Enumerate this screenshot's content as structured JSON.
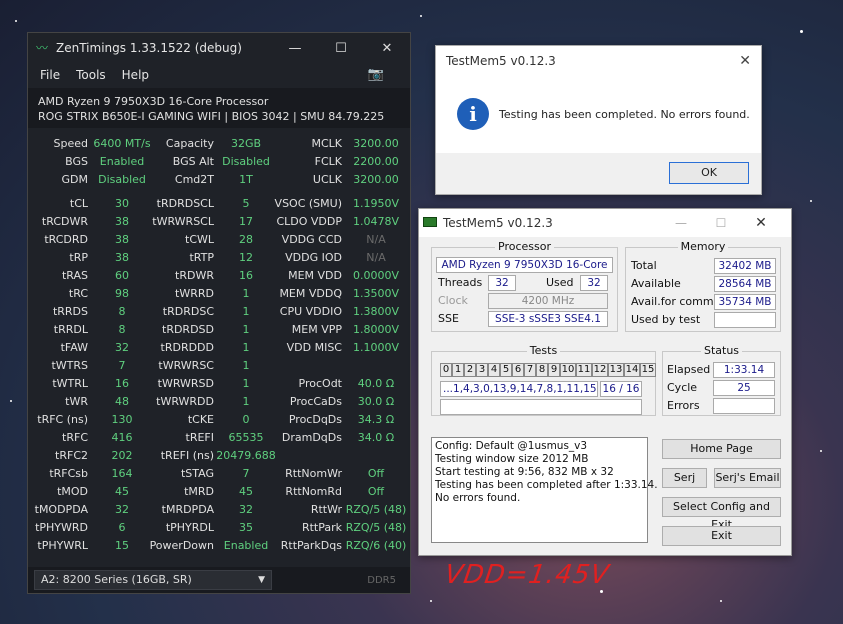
{
  "zentimings": {
    "title": "ZenTimings 1.33.1522 (debug)",
    "menu": [
      "File",
      "Tools",
      "Help"
    ],
    "cpu": "AMD Ryzen 9 7950X3D 16-Core Processor",
    "board": "ROG STRIX B650E-I GAMING WIFI | BIOS 3042 | SMU 84.79.225",
    "top_rows": [
      {
        "l1": "Speed",
        "v1": "6400 MT/s",
        "l2": "Capacity",
        "v2": "32GB",
        "l3": "MCLK",
        "v3": "3200.00"
      },
      {
        "l1": "BGS",
        "v1": "Enabled",
        "l2": "BGS Alt",
        "v2": "Disabled",
        "l3": "FCLK",
        "v3": "2200.00"
      },
      {
        "l1": "GDM",
        "v1": "Disabled",
        "l2": "Cmd2T",
        "v2": "1T",
        "l3": "UCLK",
        "v3": "3200.00"
      }
    ],
    "rows": [
      {
        "l1": "tCL",
        "v1": "30",
        "l2": "tRDRDSCL",
        "v2": "5",
        "l3": "VSOC (SMU)",
        "v3": "1.1950V"
      },
      {
        "l1": "tRCDWR",
        "v1": "38",
        "l2": "tWRWRSCL",
        "v2": "17",
        "l3": "CLDO VDDP",
        "v3": "1.0478V"
      },
      {
        "l1": "tRCDRD",
        "v1": "38",
        "l2": "tCWL",
        "v2": "28",
        "l3": "VDDG CCD",
        "v3": "N/A",
        "d": true
      },
      {
        "l1": "tRP",
        "v1": "38",
        "l2": "tRTP",
        "v2": "12",
        "l3": "VDDG IOD",
        "v3": "N/A",
        "d": true
      },
      {
        "l1": "tRAS",
        "v1": "60",
        "l2": "tRDWR",
        "v2": "16",
        "l3": "MEM VDD",
        "v3": "0.0000V"
      },
      {
        "l1": "tRC",
        "v1": "98",
        "l2": "tWRRD",
        "v2": "1",
        "l3": "MEM VDDQ",
        "v3": "1.3500V"
      },
      {
        "l1": "tRRDS",
        "v1": "8",
        "l2": "tRDRDSC",
        "v2": "1",
        "l3": "CPU VDDIO",
        "v3": "1.3800V"
      },
      {
        "l1": "tRRDL",
        "v1": "8",
        "l2": "tRDRDSD",
        "v2": "1",
        "l3": "MEM VPP",
        "v3": "1.8000V"
      },
      {
        "l1": "tFAW",
        "v1": "32",
        "l2": "tRDRDDD",
        "v2": "1",
        "l3": "VDD MISC",
        "v3": "1.1000V"
      },
      {
        "l1": "tWTRS",
        "v1": "7",
        "l2": "tWRWRSC",
        "v2": "1",
        "l3": "",
        "v3": ""
      },
      {
        "l1": "tWTRL",
        "v1": "16",
        "l2": "tWRWRSD",
        "v2": "1",
        "l3": "ProcOdt",
        "v3": "40.0 Ω"
      },
      {
        "l1": "tWR",
        "v1": "48",
        "l2": "tWRWRDD",
        "v2": "1",
        "l3": "ProcCaDs",
        "v3": "30.0 Ω"
      },
      {
        "l1": "tRFC (ns)",
        "v1": "130",
        "l2": "tCKE",
        "v2": "0",
        "l3": "ProcDqDs",
        "v3": "34.3 Ω"
      },
      {
        "l1": "tRFC",
        "v1": "416",
        "l2": "tREFI",
        "v2": "65535",
        "l3": "DramDqDs",
        "v3": "34.0 Ω"
      },
      {
        "l1": "tRFC2",
        "v1": "202",
        "l2": "tREFI (ns)",
        "v2": "20479.688",
        "l3": "",
        "v3": ""
      },
      {
        "l1": "tRFCsb",
        "v1": "164",
        "l2": "tSTAG",
        "v2": "7",
        "l3": "RttNomWr",
        "v3": "Off"
      },
      {
        "l1": "tMOD",
        "v1": "45",
        "l2": "tMRD",
        "v2": "45",
        "l3": "RttNomRd",
        "v3": "Off"
      },
      {
        "l1": "tMODPDA",
        "v1": "32",
        "l2": "tMRDPDA",
        "v2": "32",
        "l3": "RttWr",
        "v3": "RZQ/5 (48)"
      },
      {
        "l1": "tPHYWRD",
        "v1": "6",
        "l2": "tPHYRDL",
        "v2": "35",
        "l3": "RttPark",
        "v3": "RZQ/5 (48)"
      },
      {
        "l1": "tPHYWRL",
        "v1": "15",
        "l2": "PowerDown",
        "v2": "Enabled",
        "l3": "RttParkDqs",
        "v3": "RZQ/6 (40)"
      }
    ],
    "dimm_select": "A2: 8200 Series (16GB, SR)",
    "mem_type": "DDR5"
  },
  "dialog": {
    "title": "TestMem5 v0.12.3",
    "message": "Testing has been completed. No errors found.",
    "ok": "OK"
  },
  "testmem": {
    "title": "TestMem5 v0.12.3",
    "processor_label": "Processor",
    "processor": "AMD Ryzen 9 7950X3D 16-Core",
    "threads_label": "Threads",
    "threads": "32",
    "used_label": "Used",
    "used": "32",
    "clock_label": "Clock",
    "clock": "4200 MHz",
    "sse_label": "SSE",
    "sse": "SSE-3 sSSE3 SSE4.1",
    "memory_label": "Memory",
    "total_label": "Total",
    "total": "32402 MB",
    "available_label": "Available",
    "available": "28564 MB",
    "commit_label": "Avail.for commit",
    "commit": "35734 MB",
    "usedbytest_label": "Used by test",
    "usedbytest": "",
    "tests_label": "Tests",
    "test_numbers": [
      "0",
      "1",
      "2",
      "3",
      "4",
      "5",
      "6",
      "7",
      "8",
      "9",
      "10",
      "11",
      "12",
      "13",
      "14",
      "15"
    ],
    "sequence": "...1,4,3,0,13,9,14,7,8,1,11,15",
    "progress": "16 / 16",
    "status_label": "Status",
    "elapsed_label": "Elapsed",
    "elapsed": "1:33.14",
    "cycle_label": "Cycle",
    "cycle": "25",
    "errors_label": "Errors",
    "errors": "",
    "log": "Config: Default @1usmus_v3\nTesting window size 2012 MB\nStart testing at 9:56, 832 MB x 32\nTesting has been completed after 1:33.14.\nNo errors found.",
    "btn_home": "Home Page",
    "btn_serj": "Serj",
    "btn_email": "Serj's Email",
    "btn_select": "Select Config and Exit",
    "btn_exit": "Exit"
  },
  "annotation": "VDD=1.45V"
}
